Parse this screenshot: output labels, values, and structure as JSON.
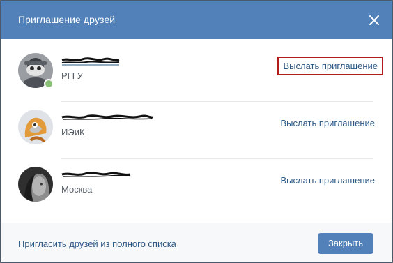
{
  "dialog": {
    "title": "Приглашение друзей",
    "close_icon": "close-icon"
  },
  "friends": [
    {
      "subtitle": "РГГУ",
      "invite_label": "Выслать приглашение",
      "online": true
    },
    {
      "subtitle": "ИЭиК",
      "invite_label": "Выслать приглашение",
      "online": false
    },
    {
      "subtitle": "Москва",
      "invite_label": "Выслать приглашение",
      "online": false
    }
  ],
  "footer": {
    "full_list_link": "Пригласить друзей из полного списка",
    "close_button": "Закрыть"
  },
  "colors": {
    "header": "#5181b8",
    "link": "#2a5885",
    "highlight": "#b11c1c",
    "online": "#8ac176"
  }
}
